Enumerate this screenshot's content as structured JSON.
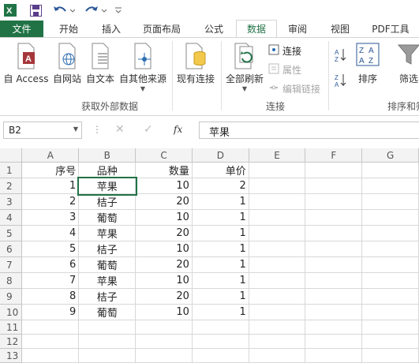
{
  "qat": {
    "excel_icon": "excel-icon",
    "save_icon": "save-icon",
    "undo_icon": "undo-icon",
    "redo_icon": "redo-icon",
    "customize_icon": "customize-qat-icon"
  },
  "tabs": [
    "文件",
    "开始",
    "插入",
    "页面布局",
    "公式",
    "数据",
    "审阅",
    "视图",
    "PDF工具"
  ],
  "ribbon": {
    "external_group_label": "获取外部数据",
    "connections_group_label": "连接",
    "sort_group_label": "排序和筛",
    "from_access": "自 Access",
    "from_web": "自网站",
    "from_text": "自文本",
    "from_other": "自其他来源",
    "existing_connections": "现有连接",
    "refresh_all": "全部刷新",
    "connections": "连接",
    "properties": "属性",
    "edit_links": "编辑链接",
    "sort": "排序",
    "filter": "筛选"
  },
  "formula_bar": {
    "name_box": "B2",
    "fx": "fx",
    "content": "苹果"
  },
  "sheet": {
    "columns": [
      "A",
      "B",
      "C",
      "D",
      "E",
      "F",
      "G"
    ],
    "rows": [
      {
        "n": "1",
        "A": "序号",
        "B": "品种",
        "C": "数量",
        "D": "单价"
      },
      {
        "n": "2",
        "A": "1",
        "B": "苹果",
        "C": "10",
        "D": "2"
      },
      {
        "n": "3",
        "A": "2",
        "B": "桔子",
        "C": "20",
        "D": "1"
      },
      {
        "n": "4",
        "A": "3",
        "B": "葡萄",
        "C": "10",
        "D": "1"
      },
      {
        "n": "5",
        "A": "4",
        "B": "苹果",
        "C": "20",
        "D": "1"
      },
      {
        "n": "6",
        "A": "5",
        "B": "桔子",
        "C": "10",
        "D": "1"
      },
      {
        "n": "7",
        "A": "6",
        "B": "葡萄",
        "C": "20",
        "D": "1"
      },
      {
        "n": "8",
        "A": "7",
        "B": "苹果",
        "C": "10",
        "D": "1"
      },
      {
        "n": "9",
        "A": "8",
        "B": "桔子",
        "C": "20",
        "D": "1"
      },
      {
        "n": "10",
        "A": "9",
        "B": "葡萄",
        "C": "10",
        "D": "1"
      },
      {
        "n": "11",
        "A": "",
        "B": "",
        "C": "",
        "D": ""
      },
      {
        "n": "12",
        "A": "",
        "B": "",
        "C": "",
        "D": ""
      },
      {
        "n": "13",
        "A": "",
        "B": "",
        "C": "",
        "D": ""
      }
    ]
  },
  "colors": {
    "accent": "#217346"
  }
}
